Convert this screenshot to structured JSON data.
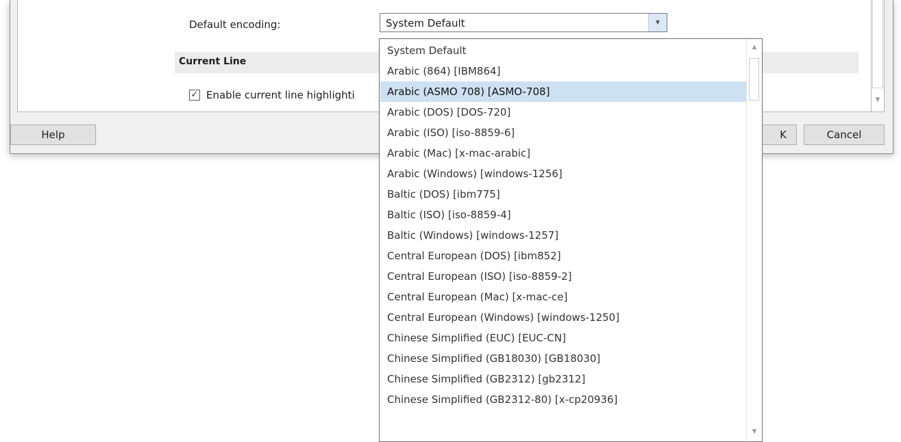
{
  "settings": {
    "encoding_label": "Default encoding:",
    "encoding_value": "System Default",
    "section_title": "Current Line",
    "checkbox_label": "Enable current line highlighti",
    "checkbox_checked": true
  },
  "buttons": {
    "help": "Help",
    "ok": "K",
    "cancel": "Cancel"
  },
  "dropdown": {
    "selected_index": 2,
    "items": [
      "System Default",
      "Arabic (864) [IBM864]",
      "Arabic (ASMO 708) [ASMO-708]",
      "Arabic (DOS) [DOS-720]",
      "Arabic (ISO) [iso-8859-6]",
      "Arabic (Mac) [x-mac-arabic]",
      "Arabic (Windows) [windows-1256]",
      "Baltic (DOS) [ibm775]",
      "Baltic (ISO) [iso-8859-4]",
      "Baltic (Windows) [windows-1257]",
      "Central European (DOS) [ibm852]",
      "Central European (ISO) [iso-8859-2]",
      "Central European (Mac) [x-mac-ce]",
      "Central European (Windows) [windows-1250]",
      "Chinese Simplified (EUC) [EUC-CN]",
      "Chinese Simplified (GB18030) [GB18030]",
      "Chinese Simplified (GB2312) [gb2312]",
      "Chinese Simplified (GB2312-80) [x-cp20936]"
    ]
  },
  "colors": {
    "selection": "#cde1f2",
    "dialog_bg": "#f0f0f0",
    "combo_button": "#dbe8f6"
  },
  "icons": {
    "check": "checkmark-icon",
    "scroll_up": "scroll-up-arrow-icon",
    "scroll_down": "scroll-down-arrow-icon",
    "combo_arrow": "chevron-down-icon"
  }
}
